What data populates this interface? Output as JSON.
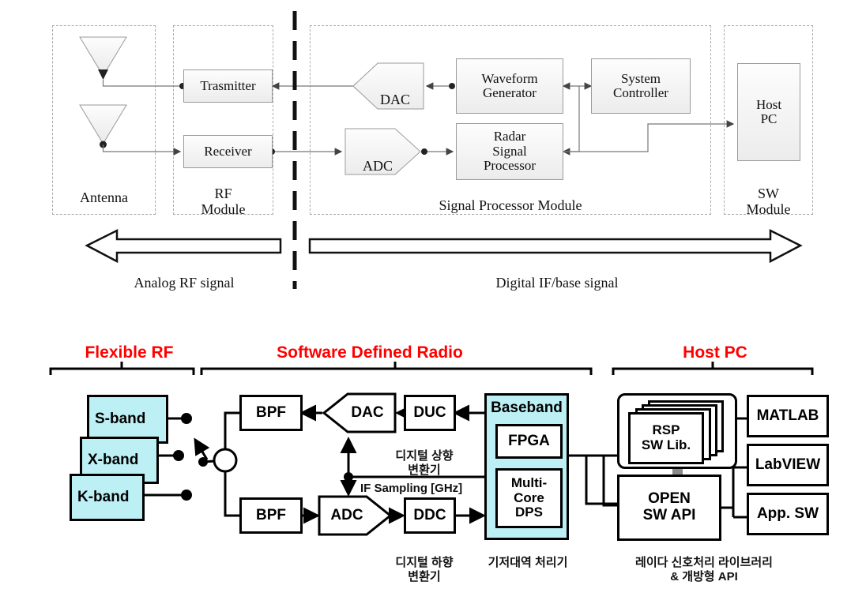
{
  "figure": {
    "top_diagram": {
      "groups": [
        {
          "name": "antenna",
          "label": "Antenna"
        },
        {
          "name": "rf-module",
          "label": "RF\nModule"
        },
        {
          "name": "signal-processor-module",
          "label": "Signal Processor Module"
        },
        {
          "name": "sw-module",
          "label": "SW\nModule"
        }
      ],
      "blocks": [
        {
          "name": "transmitter",
          "label": "Trasmitter"
        },
        {
          "name": "receiver",
          "label": "Receiver"
        },
        {
          "name": "dac",
          "label": "DAC"
        },
        {
          "name": "adc",
          "label": "ADC"
        },
        {
          "name": "waveform-generator",
          "label": "Waveform\nGenerator"
        },
        {
          "name": "radar-signal-processor",
          "label": "Radar\nSignal\nProcessor"
        },
        {
          "name": "system-controller",
          "label": "System\nController"
        },
        {
          "name": "host-pc",
          "label": "Host\nPC"
        }
      ],
      "domain_arrows": [
        {
          "name": "analog-rf-arrow",
          "label": "Analog RF signal",
          "direction": "left"
        },
        {
          "name": "digital-if-arrow",
          "label": "Digital IF/base signal",
          "direction": "right"
        }
      ]
    },
    "bottom_diagram": {
      "headings": [
        {
          "name": "flexible-rf",
          "label": "Flexible RF"
        },
        {
          "name": "software-defined-radio",
          "label": "Software Defined Radio"
        },
        {
          "name": "host-pc",
          "label": "Host PC"
        }
      ],
      "bands": [
        {
          "name": "s-band",
          "label": "S-band"
        },
        {
          "name": "x-band",
          "label": "X-band"
        },
        {
          "name": "k-band",
          "label": "K-band"
        }
      ],
      "sdr_blocks": [
        {
          "name": "bpf-tx",
          "label": "BPF"
        },
        {
          "name": "bpf-rx",
          "label": "BPF"
        },
        {
          "name": "dac",
          "label": "DAC"
        },
        {
          "name": "adc",
          "label": "ADC"
        },
        {
          "name": "duc",
          "label": "DUC"
        },
        {
          "name": "ddc",
          "label": "DDC"
        },
        {
          "name": "baseband",
          "label": "Baseband"
        },
        {
          "name": "fpga",
          "label": "FPGA"
        },
        {
          "name": "multi-core-dps",
          "label": "Multi-Core\nDPS"
        }
      ],
      "host_blocks": [
        {
          "name": "rsp-sw-lib",
          "label": "RSP\nSW Lib."
        },
        {
          "name": "open-sw-api",
          "label": "OPEN\nSW API"
        },
        {
          "name": "matlab",
          "label": "MATLAB"
        },
        {
          "name": "labview",
          "label": "LabVIEW"
        },
        {
          "name": "app-sw",
          "label": "App. SW"
        }
      ],
      "captions": [
        {
          "name": "duc-caption",
          "label": "디지털 상향\n변환기"
        },
        {
          "name": "ddc-caption",
          "label": "디지털 하향\n변환기"
        },
        {
          "name": "if-sampling-label",
          "label": "IF Sampling [GHz]"
        },
        {
          "name": "baseband-caption",
          "label": "기저대역 처리기"
        },
        {
          "name": "host-caption",
          "label": "레이다 신호처리 라이브러리\n& 개방형 API"
        }
      ]
    },
    "colors": {
      "heading_red": "#ff0000",
      "band_cyan": "#bdf0f5",
      "block_outline": "#000000",
      "top_block_border": "#9a9a9a",
      "dashed_group": "#aaaaaa"
    }
  }
}
